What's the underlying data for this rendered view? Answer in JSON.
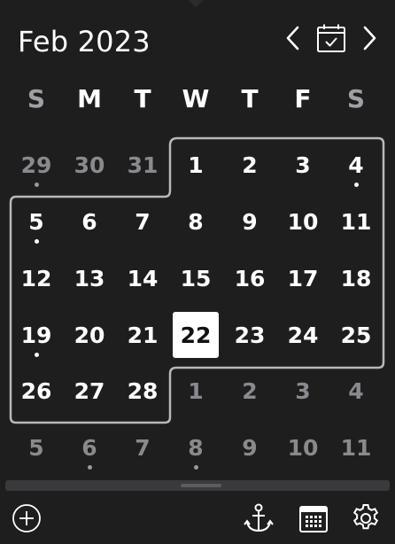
{
  "header": {
    "month_title": "Feb 2023",
    "prev_icon": "chevron-left-icon",
    "today_icon": "calendar-check-icon",
    "next_icon": "chevron-right-icon"
  },
  "weekdays": [
    "S",
    "M",
    "T",
    "W",
    "T",
    "F",
    "S"
  ],
  "weeks": [
    [
      {
        "d": "29",
        "out": true,
        "dot": true
      },
      {
        "d": "30",
        "out": true
      },
      {
        "d": "31",
        "out": true
      },
      {
        "d": "1"
      },
      {
        "d": "2"
      },
      {
        "d": "3"
      },
      {
        "d": "4",
        "dot": true
      }
    ],
    [
      {
        "d": "5",
        "dot": true
      },
      {
        "d": "6"
      },
      {
        "d": "7"
      },
      {
        "d": "8"
      },
      {
        "d": "9"
      },
      {
        "d": "10"
      },
      {
        "d": "11"
      }
    ],
    [
      {
        "d": "12"
      },
      {
        "d": "13"
      },
      {
        "d": "14"
      },
      {
        "d": "15"
      },
      {
        "d": "16"
      },
      {
        "d": "17"
      },
      {
        "d": "18"
      }
    ],
    [
      {
        "d": "19",
        "dot": true
      },
      {
        "d": "20"
      },
      {
        "d": "21"
      },
      {
        "d": "22",
        "today": true
      },
      {
        "d": "23"
      },
      {
        "d": "24"
      },
      {
        "d": "25"
      }
    ],
    [
      {
        "d": "26"
      },
      {
        "d": "27"
      },
      {
        "d": "28"
      },
      {
        "d": "1",
        "out": true
      },
      {
        "d": "2",
        "out": true
      },
      {
        "d": "3",
        "out": true
      },
      {
        "d": "4",
        "out": true
      }
    ],
    [
      {
        "d": "5",
        "out": true
      },
      {
        "d": "6",
        "out": true,
        "dot": true
      },
      {
        "d": "7",
        "out": true
      },
      {
        "d": "8",
        "out": true,
        "dot": true
      },
      {
        "d": "9",
        "out": true
      },
      {
        "d": "10",
        "out": true
      },
      {
        "d": "11",
        "out": true
      }
    ]
  ],
  "footer": {
    "add_icon": "add-circle-icon",
    "anchor_icon": "anchor-icon",
    "calendar_icon": "calendar-grid-icon",
    "settings_icon": "gear-icon"
  },
  "colors": {
    "background": "#1e1e1f",
    "text": "#ffffff",
    "muted": "#8a8a8e",
    "outline": "#b8b8bc"
  }
}
